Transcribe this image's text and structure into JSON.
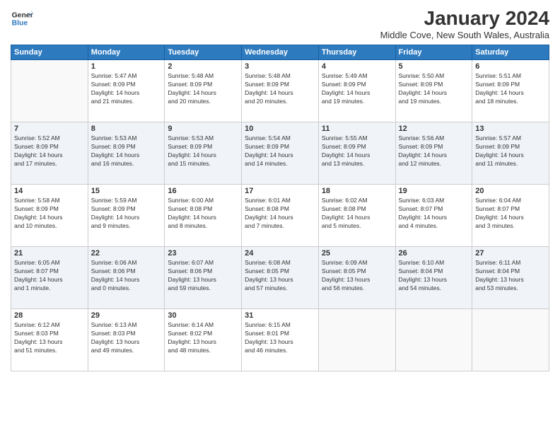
{
  "header": {
    "logo_line1": "General",
    "logo_line2": "Blue",
    "month": "January 2024",
    "location": "Middle Cove, New South Wales, Australia"
  },
  "weekdays": [
    "Sunday",
    "Monday",
    "Tuesday",
    "Wednesday",
    "Thursday",
    "Friday",
    "Saturday"
  ],
  "weeks": [
    [
      {
        "day": "",
        "info": ""
      },
      {
        "day": "1",
        "info": "Sunrise: 5:47 AM\nSunset: 8:09 PM\nDaylight: 14 hours\nand 21 minutes."
      },
      {
        "day": "2",
        "info": "Sunrise: 5:48 AM\nSunset: 8:09 PM\nDaylight: 14 hours\nand 20 minutes."
      },
      {
        "day": "3",
        "info": "Sunrise: 5:48 AM\nSunset: 8:09 PM\nDaylight: 14 hours\nand 20 minutes."
      },
      {
        "day": "4",
        "info": "Sunrise: 5:49 AM\nSunset: 8:09 PM\nDaylight: 14 hours\nand 19 minutes."
      },
      {
        "day": "5",
        "info": "Sunrise: 5:50 AM\nSunset: 8:09 PM\nDaylight: 14 hours\nand 19 minutes."
      },
      {
        "day": "6",
        "info": "Sunrise: 5:51 AM\nSunset: 8:09 PM\nDaylight: 14 hours\nand 18 minutes."
      }
    ],
    [
      {
        "day": "7",
        "info": "Sunrise: 5:52 AM\nSunset: 8:09 PM\nDaylight: 14 hours\nand 17 minutes."
      },
      {
        "day": "8",
        "info": "Sunrise: 5:53 AM\nSunset: 8:09 PM\nDaylight: 14 hours\nand 16 minutes."
      },
      {
        "day": "9",
        "info": "Sunrise: 5:53 AM\nSunset: 8:09 PM\nDaylight: 14 hours\nand 15 minutes."
      },
      {
        "day": "10",
        "info": "Sunrise: 5:54 AM\nSunset: 8:09 PM\nDaylight: 14 hours\nand 14 minutes."
      },
      {
        "day": "11",
        "info": "Sunrise: 5:55 AM\nSunset: 8:09 PM\nDaylight: 14 hours\nand 13 minutes."
      },
      {
        "day": "12",
        "info": "Sunrise: 5:56 AM\nSunset: 8:09 PM\nDaylight: 14 hours\nand 12 minutes."
      },
      {
        "day": "13",
        "info": "Sunrise: 5:57 AM\nSunset: 8:09 PM\nDaylight: 14 hours\nand 11 minutes."
      }
    ],
    [
      {
        "day": "14",
        "info": "Sunrise: 5:58 AM\nSunset: 8:09 PM\nDaylight: 14 hours\nand 10 minutes."
      },
      {
        "day": "15",
        "info": "Sunrise: 5:59 AM\nSunset: 8:09 PM\nDaylight: 14 hours\nand 9 minutes."
      },
      {
        "day": "16",
        "info": "Sunrise: 6:00 AM\nSunset: 8:08 PM\nDaylight: 14 hours\nand 8 minutes."
      },
      {
        "day": "17",
        "info": "Sunrise: 6:01 AM\nSunset: 8:08 PM\nDaylight: 14 hours\nand 7 minutes."
      },
      {
        "day": "18",
        "info": "Sunrise: 6:02 AM\nSunset: 8:08 PM\nDaylight: 14 hours\nand 5 minutes."
      },
      {
        "day": "19",
        "info": "Sunrise: 6:03 AM\nSunset: 8:07 PM\nDaylight: 14 hours\nand 4 minutes."
      },
      {
        "day": "20",
        "info": "Sunrise: 6:04 AM\nSunset: 8:07 PM\nDaylight: 14 hours\nand 3 minutes."
      }
    ],
    [
      {
        "day": "21",
        "info": "Sunrise: 6:05 AM\nSunset: 8:07 PM\nDaylight: 14 hours\nand 1 minute."
      },
      {
        "day": "22",
        "info": "Sunrise: 6:06 AM\nSunset: 8:06 PM\nDaylight: 14 hours\nand 0 minutes."
      },
      {
        "day": "23",
        "info": "Sunrise: 6:07 AM\nSunset: 8:06 PM\nDaylight: 13 hours\nand 59 minutes."
      },
      {
        "day": "24",
        "info": "Sunrise: 6:08 AM\nSunset: 8:05 PM\nDaylight: 13 hours\nand 57 minutes."
      },
      {
        "day": "25",
        "info": "Sunrise: 6:09 AM\nSunset: 8:05 PM\nDaylight: 13 hours\nand 56 minutes."
      },
      {
        "day": "26",
        "info": "Sunrise: 6:10 AM\nSunset: 8:04 PM\nDaylight: 13 hours\nand 54 minutes."
      },
      {
        "day": "27",
        "info": "Sunrise: 6:11 AM\nSunset: 8:04 PM\nDaylight: 13 hours\nand 53 minutes."
      }
    ],
    [
      {
        "day": "28",
        "info": "Sunrise: 6:12 AM\nSunset: 8:03 PM\nDaylight: 13 hours\nand 51 minutes."
      },
      {
        "day": "29",
        "info": "Sunrise: 6:13 AM\nSunset: 8:03 PM\nDaylight: 13 hours\nand 49 minutes."
      },
      {
        "day": "30",
        "info": "Sunrise: 6:14 AM\nSunset: 8:02 PM\nDaylight: 13 hours\nand 48 minutes."
      },
      {
        "day": "31",
        "info": "Sunrise: 6:15 AM\nSunset: 8:01 PM\nDaylight: 13 hours\nand 46 minutes."
      },
      {
        "day": "",
        "info": ""
      },
      {
        "day": "",
        "info": ""
      },
      {
        "day": "",
        "info": ""
      }
    ]
  ]
}
